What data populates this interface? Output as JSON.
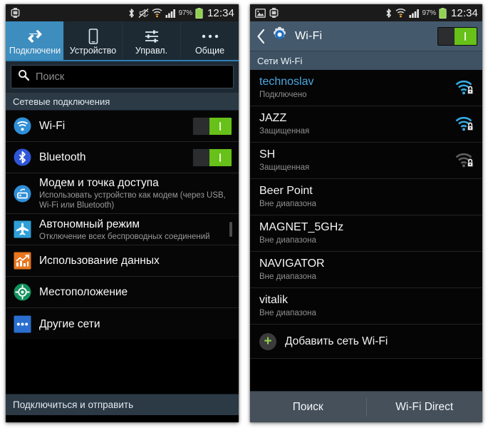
{
  "left_phone": {
    "status_bar": {
      "icons": [
        "smartwatch-icon",
        "bluetooth-icon",
        "vibrate-mute-icon",
        "wifi-icon",
        "cell-signal-icon"
      ],
      "battery_percent": "97%",
      "time": "12:34"
    },
    "tabs": [
      {
        "label": "Подключени",
        "icon": "connections-arrows-icon",
        "active": true
      },
      {
        "label": "Устройство",
        "icon": "phone-device-icon",
        "active": false
      },
      {
        "label": "Управл.",
        "icon": "sliders-icon",
        "active": false
      },
      {
        "label": "Общие",
        "icon": "more-dots-icon",
        "active": false
      }
    ],
    "search": {
      "placeholder": "Поиск",
      "value": "",
      "icon": "search-icon"
    },
    "section_header": "Сетевые подключения",
    "rows": [
      {
        "title": "Wi-Fi",
        "sub": "",
        "icon": "wifi-round-icon",
        "control": "toggle-on"
      },
      {
        "title": "Bluetooth",
        "sub": "",
        "icon": "bluetooth-round-icon",
        "control": "toggle-on"
      },
      {
        "title": "Модем и точка доступа",
        "sub": "Использовать устройство как модем (через USB, Wi-Fi или Bluetooth)",
        "icon": "tethering-icon",
        "control": "none"
      },
      {
        "title": "Автономный режим",
        "sub": "Отключение всех беспроводных соединений",
        "icon": "airplane-icon",
        "control": "checkbox-off"
      },
      {
        "title": "Использование данных",
        "sub": "",
        "icon": "data-usage-icon",
        "control": "none"
      },
      {
        "title": "Местоположение",
        "sub": "",
        "icon": "location-icon",
        "control": "none"
      },
      {
        "title": "Другие сети",
        "sub": "",
        "icon": "more-networks-icon",
        "control": "none"
      }
    ],
    "footer": "Подключиться и отправить"
  },
  "right_phone": {
    "status_bar": {
      "icons": [
        "image-icon",
        "smartwatch-icon",
        "bluetooth-icon",
        "wifi-icon",
        "cell-signal-icon"
      ],
      "battery_percent": "97%",
      "time": "12:34"
    },
    "appbar": {
      "back_icon": "back-chevron-icon",
      "app_icon": "settings-gear-icon",
      "title": "Wi-Fi",
      "toggle": "toggle-on"
    },
    "section_header": "Сети Wi-Fi",
    "networks": [
      {
        "name": "technoslav",
        "status": "Подключено",
        "signal": "wifi-strong-secured-icon",
        "connected": true,
        "secured": true,
        "in_range": true
      },
      {
        "name": "JAZZ",
        "status": "Защищенная",
        "signal": "wifi-strong-secured-icon",
        "connected": false,
        "secured": true,
        "in_range": true
      },
      {
        "name": "SH",
        "status": "Защищенная",
        "signal": "wifi-weak-secured-icon",
        "connected": false,
        "secured": true,
        "in_range": true
      },
      {
        "name": "Beer Point",
        "status": "Вне диапазона",
        "signal": "none",
        "connected": false,
        "secured": false,
        "in_range": false
      },
      {
        "name": "MAGNET_5GHz",
        "status": "Вне диапазона",
        "signal": "none",
        "connected": false,
        "secured": false,
        "in_range": false
      },
      {
        "name": "NAVIGATOR",
        "status": "Вне диапазона",
        "signal": "none",
        "connected": false,
        "secured": false,
        "in_range": false
      },
      {
        "name": "vitalik",
        "status": "Вне диапазона",
        "signal": "none",
        "connected": false,
        "secured": false,
        "in_range": false
      }
    ],
    "add_network": {
      "label": "Добавить сеть Wi-Fi",
      "icon": "plus-circle-icon"
    },
    "bottom_bar": [
      {
        "label": "Поиск"
      },
      {
        "label": "Wi-Fi Direct"
      }
    ]
  },
  "colors": {
    "accent_blue": "#3d8dbe",
    "toggle_green": "#67c118",
    "connected_blue": "#4aa8e0",
    "appbar_blue": "#44596b",
    "wifi_signal_blue": "#36a8e0"
  }
}
